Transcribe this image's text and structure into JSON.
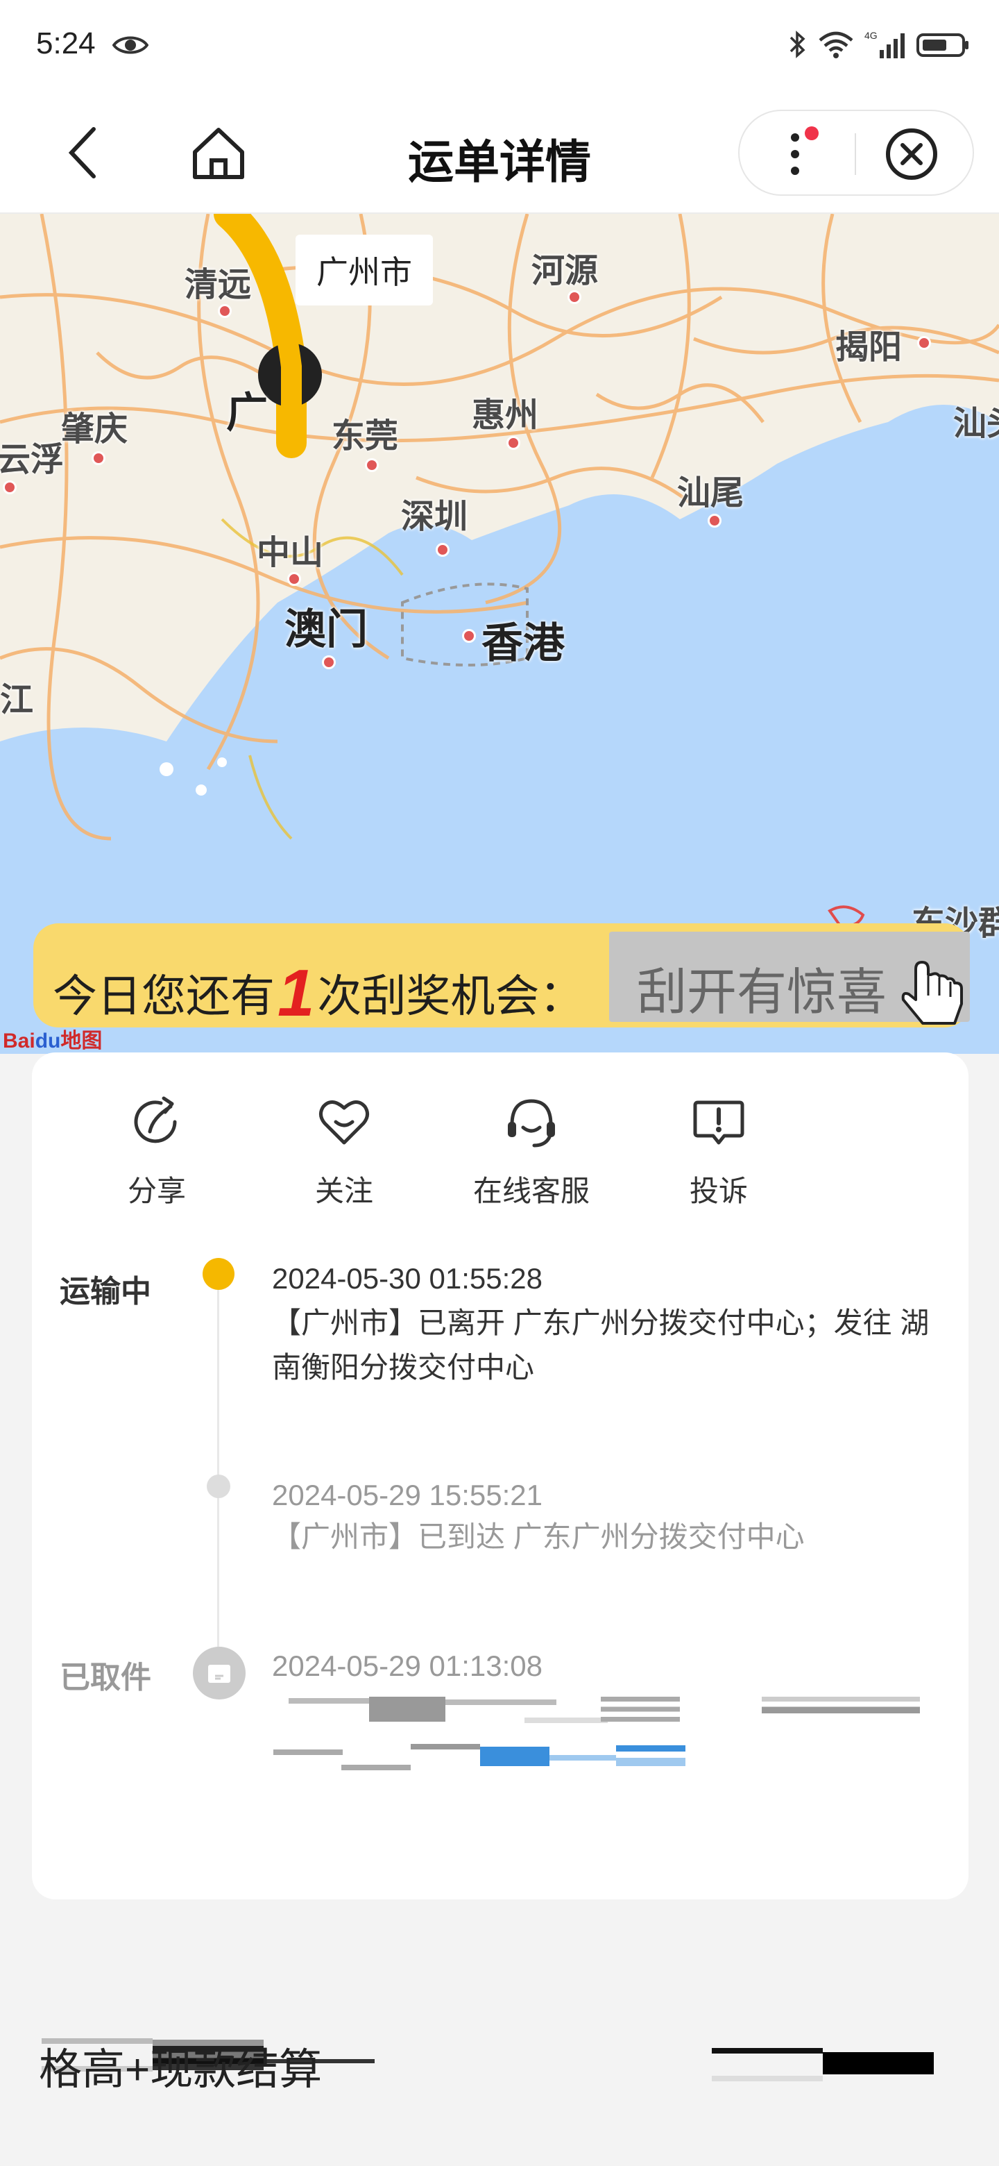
{
  "status_bar": {
    "time": "5:24",
    "network": "4G"
  },
  "nav": {
    "title": "运单详情"
  },
  "map": {
    "city_tag": "广州市",
    "labels": [
      "清远",
      "河源",
      "揭阳",
      "肇庆",
      "东莞",
      "惠州",
      "汕头",
      "云浮",
      "中山",
      "深圳",
      "汕尾",
      "澳门",
      "香港",
      "江",
      "东沙群",
      "广"
    ],
    "logo_bai": "Bai",
    "logo_du": "du",
    "logo_map": "地图"
  },
  "scratch": {
    "prefix": "今日您还有",
    "count": "1",
    "suffix": "次刮奖机会：",
    "area_label": "刮开有惊喜"
  },
  "actions": [
    {
      "label": "分享",
      "icon": "share-icon"
    },
    {
      "label": "关注",
      "icon": "heart-icon"
    },
    {
      "label": "在线客服",
      "icon": "headset-icon"
    },
    {
      "label": "投诉",
      "icon": "complaint-icon"
    }
  ],
  "timeline": [
    {
      "status": "运输中",
      "time": "2024-05-30 01:55:28",
      "desc": "【广州市】已离开 广东广州分拨交付中心；发往 湖南衡阳分拨交付中心"
    },
    {
      "status": "",
      "time": "2024-05-29 15:55:21",
      "desc": "【广州市】已到达 广东广州分拨交付中心"
    },
    {
      "status": "已取件",
      "time": "2024-05-29 01:13:08",
      "desc": ""
    }
  ],
  "bottom": {
    "text": "格高+现款结算"
  },
  "colors": {
    "accent": "#f5b800",
    "banner": "#f9d96d",
    "red": "#e32020",
    "sea": "#b5d7fb"
  }
}
